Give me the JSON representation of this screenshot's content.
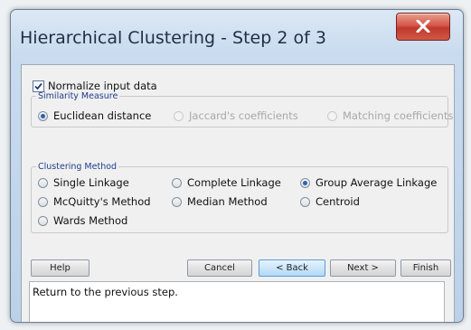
{
  "window": {
    "title": "Hierarchical Clustering - Step 2 of 3"
  },
  "normalize": {
    "label": "Normalize input data",
    "checked": true
  },
  "similarity": {
    "legend": "Similarity Measure",
    "options": [
      {
        "label": "Euclidean distance",
        "selected": true,
        "disabled": false
      },
      {
        "label": "Jaccard's coefficients",
        "selected": false,
        "disabled": true
      },
      {
        "label": "Matching coefficients",
        "selected": false,
        "disabled": true
      }
    ]
  },
  "method": {
    "legend": "Clustering Method",
    "options": [
      {
        "label": "Single Linkage",
        "selected": false
      },
      {
        "label": "Complete Linkage",
        "selected": false
      },
      {
        "label": "Group Average Linkage",
        "selected": true
      },
      {
        "label": "McQuitty's Method",
        "selected": false
      },
      {
        "label": "Median Method",
        "selected": false
      },
      {
        "label": "Centroid",
        "selected": false
      },
      {
        "label": "Wards Method",
        "selected": false
      }
    ]
  },
  "buttons": {
    "help": "Help",
    "cancel": "Cancel",
    "back": "< Back",
    "next": "Next >",
    "finish": "Finish"
  },
  "status": {
    "text": "Return to the previous step."
  },
  "colors": {
    "accent": "#2f5fb0",
    "close": "#c0382d",
    "focused_button": "#b3d9f6"
  },
  "icons": {
    "close": "close-icon",
    "check": "checkmark-icon"
  }
}
